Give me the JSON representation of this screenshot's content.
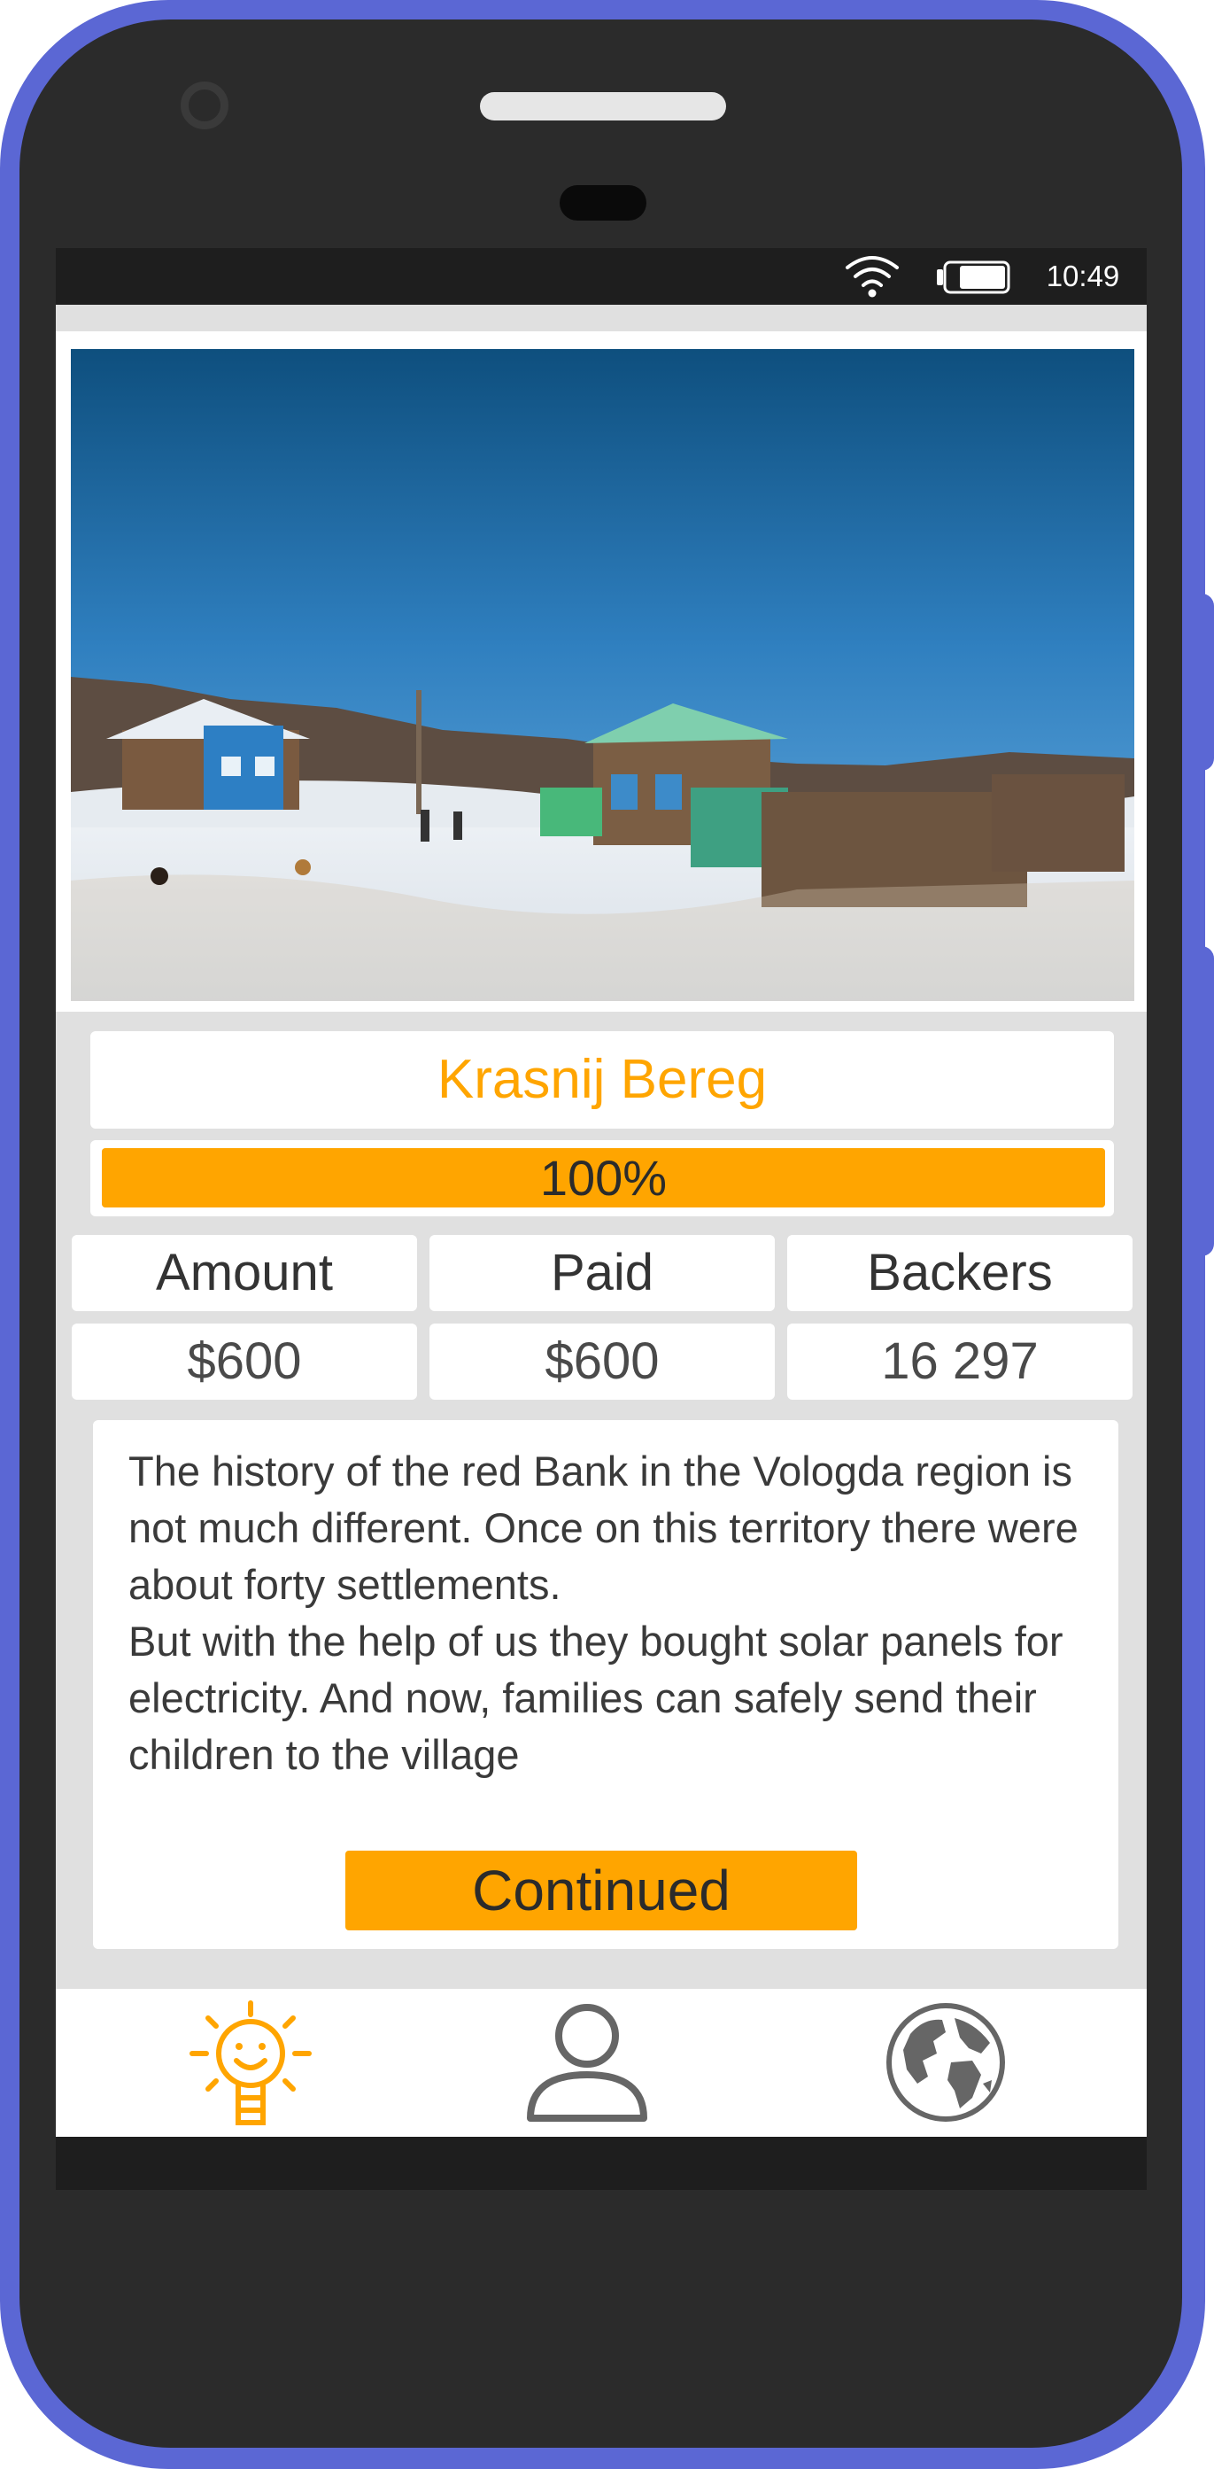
{
  "status_bar": {
    "time": "10:49"
  },
  "project": {
    "title": "Krasnij Bereg",
    "progress_percent": 100,
    "progress_label": "100%",
    "stats": [
      {
        "label": "Amount",
        "value": "$600"
      },
      {
        "label": "Paid",
        "value": "$600"
      },
      {
        "label": "Backers",
        "value": "16 297"
      }
    ],
    "description": "The history of the red Bank in the Vologda region is not much different. Once on this territory there were about forty settlements.\nBut with the help of us they bought solar panels for electricity. And now, families can safely send their children to the village",
    "continue_label": "Continued"
  },
  "nav": {
    "items": [
      {
        "icon": "lightbulb-sun-icon",
        "active": true
      },
      {
        "icon": "user-profile-icon",
        "active": false
      },
      {
        "icon": "globe-icon",
        "active": false
      }
    ]
  },
  "colors": {
    "accent": "#ffa500",
    "phone_frame": "#5b67d4",
    "phone_body": "#2b2b2b",
    "screen_bg": "#e0e0e0",
    "icon_gray": "#666666"
  }
}
